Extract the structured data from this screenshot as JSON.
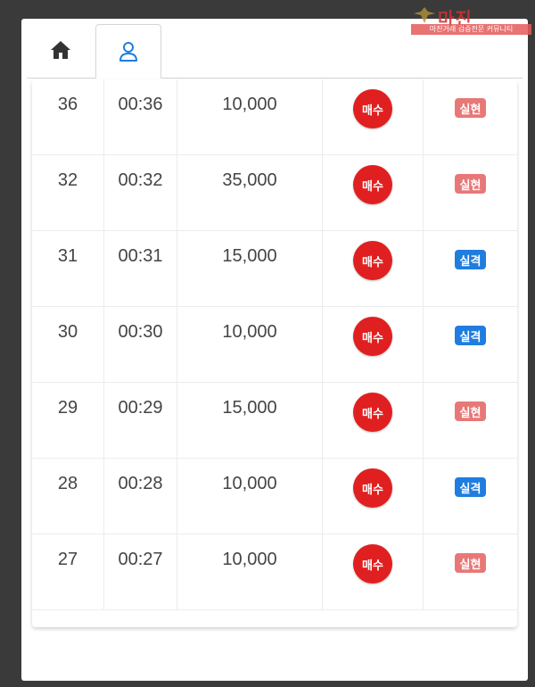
{
  "colors": {
    "buy": "#e02020",
    "loss_badge": "#e87878",
    "fail_badge": "#1f7de0",
    "active_tab_icon": "#1f7de0"
  },
  "tabs": [
    {
      "icon": "home-icon",
      "active": false
    },
    {
      "icon": "user-icon",
      "active": true
    }
  ],
  "watermark": {
    "title": "마진",
    "subtitle": "마진거래 검증전문 커뮤니티"
  },
  "rows": [
    {
      "no": "36",
      "time": "00:36",
      "amount": "10,000",
      "action": "매수",
      "result": "실현",
      "result_type": "loss"
    },
    {
      "no": "32",
      "time": "00:32",
      "amount": "35,000",
      "action": "매수",
      "result": "실현",
      "result_type": "loss"
    },
    {
      "no": "31",
      "time": "00:31",
      "amount": "15,000",
      "action": "매수",
      "result": "실격",
      "result_type": "fail"
    },
    {
      "no": "30",
      "time": "00:30",
      "amount": "10,000",
      "action": "매수",
      "result": "실격",
      "result_type": "fail"
    },
    {
      "no": "29",
      "time": "00:29",
      "amount": "15,000",
      "action": "매수",
      "result": "실현",
      "result_type": "loss"
    },
    {
      "no": "28",
      "time": "00:28",
      "amount": "10,000",
      "action": "매수",
      "result": "실격",
      "result_type": "fail"
    },
    {
      "no": "27",
      "time": "00:27",
      "amount": "10,000",
      "action": "매수",
      "result": "실현",
      "result_type": "loss"
    }
  ]
}
